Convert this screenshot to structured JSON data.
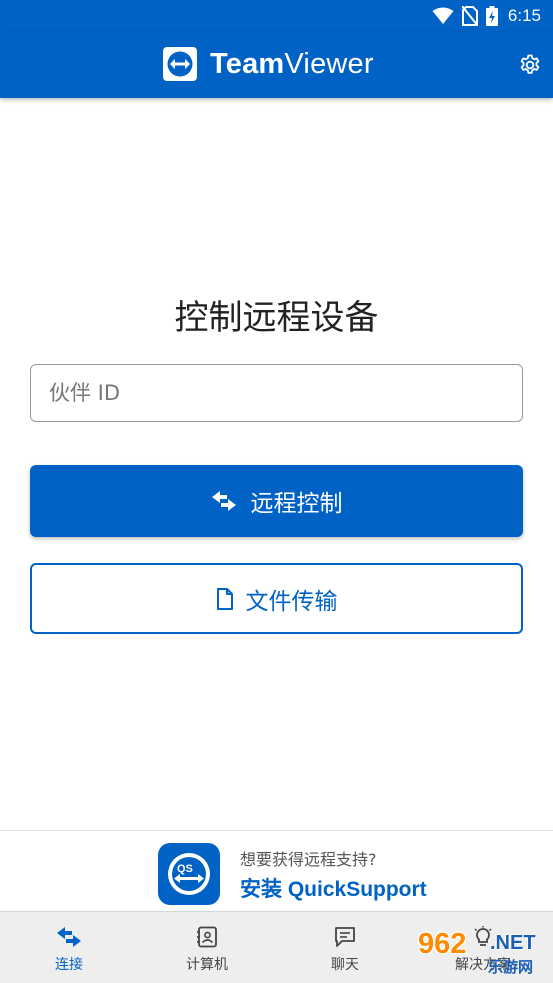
{
  "status_bar": {
    "time": "6:15",
    "icons": [
      "wifi-icon",
      "no-sim-icon",
      "battery-charging-icon"
    ]
  },
  "app_bar": {
    "brand_bold": "Team",
    "brand_light": "Viewer",
    "settings_icon": "gear-icon"
  },
  "main": {
    "title": "控制远程设备",
    "partner_id_placeholder": "伙伴 ID",
    "remote_control_label": "远程控制",
    "file_transfer_label": "文件传输"
  },
  "quicksupport": {
    "question": "想要获得远程支持?",
    "link_label": "安装 QuickSupport"
  },
  "bottom_nav": {
    "items": [
      {
        "label": "连接",
        "icon": "swap-arrows-icon",
        "active": true
      },
      {
        "label": "计算机",
        "icon": "contacts-book-icon",
        "active": false
      },
      {
        "label": "聊天",
        "icon": "chat-icon",
        "active": false
      },
      {
        "label": "解决方案",
        "icon": "lightbulb-icon",
        "active": false
      }
    ]
  },
  "watermark": {
    "number": "962",
    "domain": ".NET",
    "cn": "乐游网"
  },
  "colors": {
    "brand_blue": "#0062c4",
    "nav_bg": "#eeeeee"
  }
}
